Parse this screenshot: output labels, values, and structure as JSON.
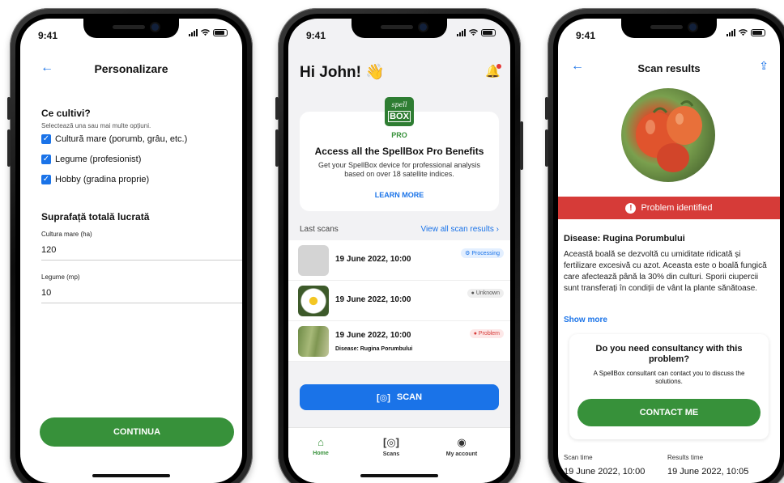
{
  "status_time": "9:41",
  "screen1": {
    "title": "Personalizare",
    "section1": "Ce cultivi?",
    "hint": "Selectează una sau mai multe opțiuni.",
    "options": [
      "Cultură mare (porumb, grâu, etc.)",
      "Legume (profesionist)",
      "Hobby (gradina proprie)"
    ],
    "section2": "Suprafață totală lucrată",
    "field1_label": "Cultura mare (ha)",
    "field1_value": "120",
    "field2_label": "Legume (mp)",
    "field2_value": "10",
    "continue_label": "CONTINUA"
  },
  "screen2": {
    "greeting": "Hi John! 👋",
    "logo_top": "spell",
    "logo_bottom": "BOX",
    "pro_badge": "PRO",
    "pro_title": "Access all the SpellBox Pro Benefits",
    "pro_body": "Get your SpellBox device for professional analysis based on over 18 satellite indices.",
    "learn_more": "LEARN MORE",
    "last_scans": "Last scans",
    "view_all": "View all scan results",
    "scans": [
      {
        "date": "19 June 2022, 10:00",
        "sub": "",
        "status": "Processing"
      },
      {
        "date": "19 June 2022, 10:00",
        "sub": "",
        "status": "Unknown"
      },
      {
        "date": "19 June 2022, 10:00",
        "sub": "Disease: Rugina Porumbului",
        "status": "Problem"
      }
    ],
    "scan_button": "SCAN",
    "tabs": [
      "Home",
      "Scans",
      "My account"
    ]
  },
  "screen3": {
    "title": "Scan results",
    "banner": "Problem identified",
    "disease": "Disease: Rugina Porumbului",
    "description": "Această boală se dezvoltă cu umiditate ridicată și fertilizare excesivă cu azot. Aceasta este o boală fungică care afectează până la 30% din culturi. Sporii ciupercii sunt transferați în condiții de vânt la plante sănătoase.",
    "show_more": "Show more",
    "consult_q": "Do you need consultancy with this problem?",
    "consult_s": "A SpellBox consultant can contact you to discuss the solutions.",
    "contact": "CONTACT ME",
    "scan_time_label": "Scan time",
    "results_time_label": "Results time",
    "scan_time": "19 June 2022, 10:00",
    "results_time": "19 June 2022, 10:05"
  },
  "colors": {
    "accent": "#1a73e8",
    "brand_green": "#37913a",
    "problem_red": "#d63b38"
  }
}
